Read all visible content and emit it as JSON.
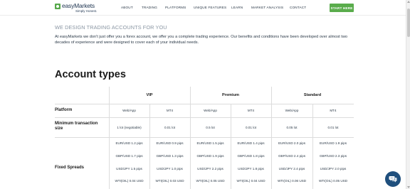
{
  "header": {
    "logo_name": "easyMarkets",
    "logo_tagline": "Simply Honest.",
    "nav": [
      "ABOUT",
      "TRADING",
      "PLATFORMS",
      "UNIQUE FEATURES",
      "LEARN",
      "MARKET ANALYSIS",
      "CONTACT"
    ],
    "cta_label": "START HERE"
  },
  "intro": {
    "subheading": "WE DESIGN TRADING ACCOUNTS FOR YOU",
    "text": "At easyMarkets we don't just offer you a forex account, we offer you a complete trading experience. Our benefits and conditions have been developed over almost two decades of experience and were designed to cover each of your individual needs."
  },
  "account_types": {
    "title": "Account types",
    "accounts": [
      "VIP",
      "Premium",
      "Standard"
    ],
    "rows": {
      "platform": {
        "label": "Platform",
        "values": [
          "Web/App",
          "MT4",
          "Web/App",
          "MT4",
          "Web/App",
          "MT4"
        ]
      },
      "min_size": {
        "label": "Minimum transaction size",
        "values": [
          "1 lot (negotiable)",
          "0.01 lot",
          "0.5 lot",
          "0.01 lot",
          "0.05 lot",
          "0.01 lot"
        ]
      },
      "spreads": {
        "label": "Fixed Spreads",
        "lines": [
          [
            "EUR/USD 1.2 pips",
            "EUR/USD 0.9 pips",
            "EUR/USD 1.5 pips",
            "EUR/USD 1.4 pips",
            "EUR/USD 2.0 pips",
            "EUR/USD 1.9 pips"
          ],
          [
            "GBP/USD 1.7 pips",
            "GBP/USD 1.3 pips",
            "GBP/USD 1.9 pips",
            "GBP/USD 1.8 pips",
            "GBP/USD 2.4 pips",
            "GBP/USD 2.3 pips"
          ],
          [
            "USD/JPY 1.5 pips",
            "USD/JPY 1.0 pips",
            "USD/JPY 2.2 pips",
            "USD/JPY 1.8 pips",
            "USD/JPY 2.4 pips",
            "USD/JPY 2.0 pips"
          ],
          [
            "WTI(OIL) 0.04 USD",
            "WTI(OIL) 0.03 USD",
            "WTI(OIL) 0.05 USD",
            "WTI(OIL) 0.04 USD",
            "WTI(OIL) 0.06 USD",
            "WTI(OIL) 0.05 USD"
          ]
        ]
      }
    }
  },
  "colors": {
    "brand_green": "#5aac4c",
    "navy": "#1f3551",
    "chat_bg": "#1f4f7d"
  },
  "icons": {
    "chat": "chat-bubbles-icon"
  }
}
